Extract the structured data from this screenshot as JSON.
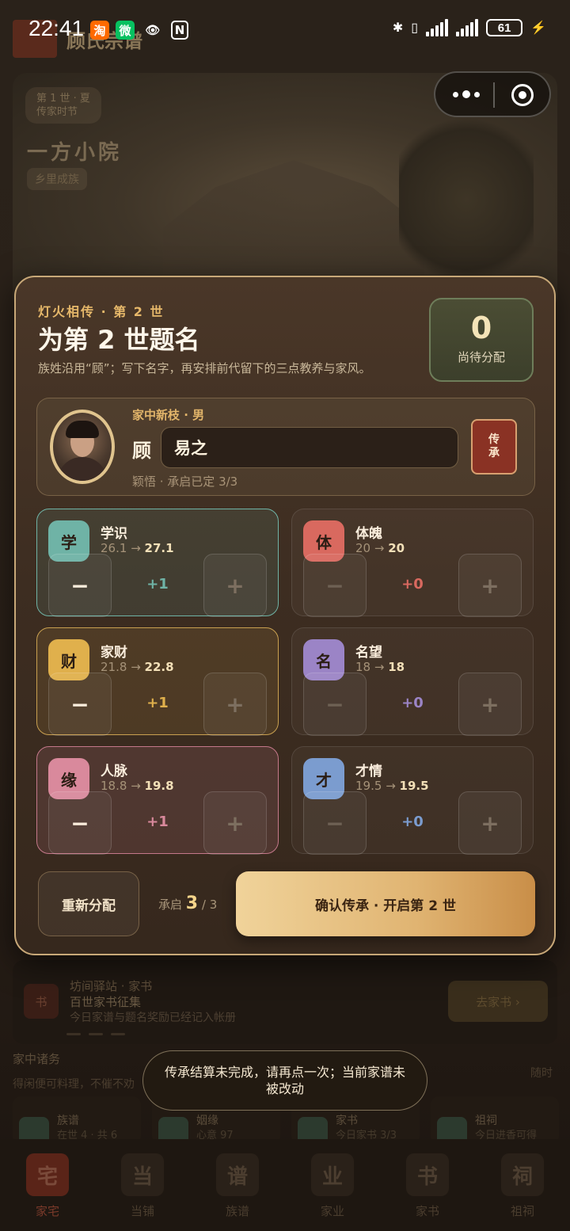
{
  "status_bar": {
    "time": "22:41",
    "app_badges": [
      "淘",
      "微",
      "👁",
      "N"
    ],
    "battery": "61"
  },
  "background": {
    "family_title": "顾氏宗谱",
    "season_chip_line1": "第 1 世 · 夏",
    "season_chip_line2": "传家时节",
    "estate_name": "一方小院",
    "estate_tag": "乡里成族",
    "banner": {
      "icon": "书",
      "line1": "坊间驿站 · 家书",
      "line2": "百世家书征集",
      "line3": "今日家谱与题名奖励已经记入帐册",
      "cta": "去家书 ›"
    },
    "section_title": "家中诸务",
    "section_hint": "得闲便可料理，不催不劝",
    "section_right": "随时",
    "cards": [
      {
        "title": "族谱",
        "sub": "在世 4 · 共 6"
      },
      {
        "title": "姻缘",
        "sub": "心意 97"
      },
      {
        "title": "家书",
        "sub": "今日家书 3/3"
      },
      {
        "title": "祖祠",
        "sub": "今日进香可得"
      }
    ],
    "nav": [
      {
        "glyph": "宅",
        "label": "家宅"
      },
      {
        "glyph": "当",
        "label": "当铺"
      },
      {
        "glyph": "谱",
        "label": "族谱"
      },
      {
        "glyph": "业",
        "label": "家业"
      },
      {
        "glyph": "书",
        "label": "家书"
      },
      {
        "glyph": "祠",
        "label": "祖祠"
      }
    ]
  },
  "modal": {
    "eyebrow": "灯火相传 · 第 2 世",
    "title": "为第 2 世题名",
    "subtitle": "族姓沿用“顾”；写下名字，再安排前代留下的三点教养与家风。",
    "pending": {
      "value": "0",
      "label": "尚待分配"
    },
    "heir": {
      "tag": "家中新枝 · 男",
      "surname": "顾",
      "given_name": "易之",
      "note": "颖悟 · 承启已定 3/3",
      "pass_button": "传承"
    },
    "stats": [
      {
        "badge": "学",
        "name": "学识",
        "from": "26.1",
        "to": "27.1",
        "delta": "+1",
        "color": "#6fb3a6"
      },
      {
        "badge": "体",
        "name": "体魄",
        "from": "20",
        "to": "20",
        "delta": "+0",
        "color": "#d9695f"
      },
      {
        "badge": "财",
        "name": "家财",
        "from": "21.8",
        "to": "22.8",
        "delta": "+1",
        "color": "#e0b04c"
      },
      {
        "badge": "名",
        "name": "名望",
        "from": "18",
        "to": "18",
        "delta": "+0",
        "color": "#9b84c6"
      },
      {
        "badge": "缘",
        "name": "人脉",
        "from": "18.8",
        "to": "19.8",
        "delta": "+1",
        "color": "#d9899c"
      },
      {
        "badge": "才",
        "name": "才情",
        "from": "19.5",
        "to": "19.5",
        "delta": "+0",
        "color": "#7b9ccf"
      }
    ],
    "minus_label": "−",
    "plus_label": "+",
    "arrow": "→",
    "reset_button": "重新分配",
    "inherit_label": "承启",
    "inherit_current": "3",
    "inherit_total": "/ 3",
    "confirm_button": "确认传承 · 开启第 2 世"
  },
  "toast": "传承结算未完成，请再点一次；当前家谱未被改动"
}
